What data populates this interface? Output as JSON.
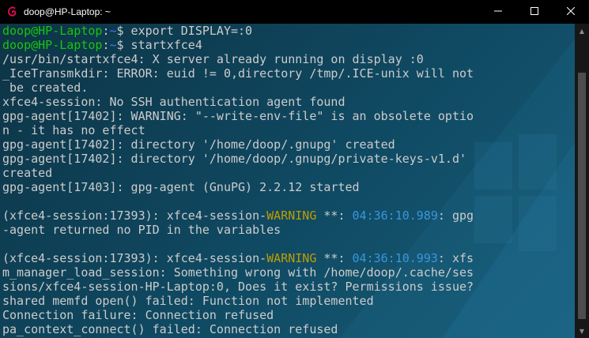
{
  "window": {
    "title": "doop@HP-Laptop: ~",
    "buttons": {
      "minimize": "minimize",
      "maximize": "maximize",
      "close": "close"
    }
  },
  "colors": {
    "prompt_user": "#16c60c",
    "prompt_path": "#3b78ff",
    "text": "#cccccc",
    "warning": "#c19c00",
    "timestamp": "#3a96dd",
    "background": "#0e3446"
  },
  "terminal": {
    "lines": [
      {
        "segments": [
          {
            "t": "doop@HP-Laptop",
            "c": "green"
          },
          {
            "t": ":",
            "c": "white"
          },
          {
            "t": "~",
            "c": "blue"
          },
          {
            "t": "$ export DISPLAY=:0",
            "c": "white"
          }
        ]
      },
      {
        "segments": [
          {
            "t": "doop@HP-Laptop",
            "c": "green"
          },
          {
            "t": ":",
            "c": "white"
          },
          {
            "t": "~",
            "c": "blue"
          },
          {
            "t": "$ startxfce4",
            "c": "white"
          }
        ]
      },
      {
        "segments": [
          {
            "t": "/usr/bin/startxfce4: X server already running on display :0",
            "c": "white"
          }
        ]
      },
      {
        "segments": [
          {
            "t": "_IceTransmkdir: ERROR: euid != 0,directory /tmp/.ICE-unix will not",
            "c": "white"
          }
        ]
      },
      {
        "segments": [
          {
            "t": " be created.",
            "c": "white"
          }
        ]
      },
      {
        "segments": [
          {
            "t": "xfce4-session: No SSH authentication agent found",
            "c": "white"
          }
        ]
      },
      {
        "segments": [
          {
            "t": "gpg-agent[17402]: WARNING: \"--write-env-file\" is an obsolete optio",
            "c": "white"
          }
        ]
      },
      {
        "segments": [
          {
            "t": "n - it has no effect",
            "c": "white"
          }
        ]
      },
      {
        "segments": [
          {
            "t": "gpg-agent[17402]: directory '/home/doop/.gnupg' created",
            "c": "white"
          }
        ]
      },
      {
        "segments": [
          {
            "t": "gpg-agent[17402]: directory '/home/doop/.gnupg/private-keys-v1.d'",
            "c": "white"
          }
        ]
      },
      {
        "segments": [
          {
            "t": "created",
            "c": "white"
          }
        ]
      },
      {
        "segments": [
          {
            "t": "gpg-agent[17403]: gpg-agent (GnuPG) 2.2.12 started",
            "c": "white"
          }
        ]
      },
      {
        "segments": [
          {
            "t": "",
            "c": "white"
          }
        ]
      },
      {
        "segments": [
          {
            "t": "(xfce4-session:17393): xfce4-session-",
            "c": "white"
          },
          {
            "t": "WARNING",
            "c": "yellow"
          },
          {
            "t": " **: ",
            "c": "white"
          },
          {
            "t": "04:36:10.989",
            "c": "cyan"
          },
          {
            "t": ": gpg",
            "c": "white"
          }
        ]
      },
      {
        "segments": [
          {
            "t": "-agent returned no PID in the variables",
            "c": "white"
          }
        ]
      },
      {
        "segments": [
          {
            "t": "",
            "c": "white"
          }
        ]
      },
      {
        "segments": [
          {
            "t": "(xfce4-session:17393): xfce4-session-",
            "c": "white"
          },
          {
            "t": "WARNING",
            "c": "yellow"
          },
          {
            "t": " **: ",
            "c": "white"
          },
          {
            "t": "04:36:10.993",
            "c": "cyan"
          },
          {
            "t": ": xfs",
            "c": "white"
          }
        ]
      },
      {
        "segments": [
          {
            "t": "m_manager_load_session: Something wrong with /home/doop/.cache/ses",
            "c": "white"
          }
        ]
      },
      {
        "segments": [
          {
            "t": "sions/xfce4-session-HP-Laptop:0, Does it exist? Permissions issue?",
            "c": "white"
          }
        ]
      },
      {
        "segments": [
          {
            "t": "shared memfd open() failed: Function not implemented",
            "c": "white"
          }
        ]
      },
      {
        "segments": [
          {
            "t": "Connection failure: Connection refused",
            "c": "white"
          }
        ]
      },
      {
        "segments": [
          {
            "t": "pa_context_connect() failed: Connection refused",
            "c": "white"
          }
        ]
      }
    ]
  },
  "icons": {
    "app": "debian-swirl-icon",
    "minimize": "minimize-icon",
    "maximize": "maximize-icon",
    "close": "close-icon",
    "scroll_up": "arrow-up-icon",
    "scroll_down": "arrow-down-icon"
  },
  "scrollbar": {
    "up_glyph": "▲",
    "down_glyph": "▼"
  }
}
